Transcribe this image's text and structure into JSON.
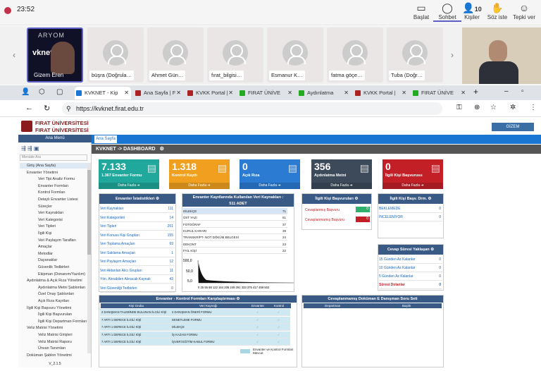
{
  "teams": {
    "time": "23:52",
    "buttons": [
      {
        "label": "Başlat",
        "icon": "▭"
      },
      {
        "label": "Sohbet",
        "icon": "◯"
      },
      {
        "label": "Kişiler",
        "icon": "👤",
        "count": "10"
      },
      {
        "label": "Söz iste",
        "icon": "✋"
      },
      {
        "label": "Tepki ver",
        "icon": "☺"
      }
    ]
  },
  "participants": [
    {
      "name": "Gizem Eren",
      "logo1": "ARYOM",
      "logo2": "vknet"
    },
    {
      "name": "büşra (Doğrula…"
    },
    {
      "name": "Ahmet Gün…"
    },
    {
      "name": "fırat_bilgisi…"
    },
    {
      "name": "Esmanur K…"
    },
    {
      "name": "fatma göçe…"
    },
    {
      "name": "Tuba (Doğr…"
    }
  ],
  "browser": {
    "tabs": [
      "KVKNET - Kip",
      "Ana Sayfa | F",
      "KVKK Portal |",
      "FIRAT ÜNİVE",
      "Aydınlatma",
      "KVKK Portal |",
      "FIRAT ÜNİVE"
    ],
    "url": "https://kvknet.firat.edu.tr"
  },
  "app": {
    "uni1": "FIRAT ÜNİVERSİTESİ",
    "uni2": "FIRAT ÜNİVERSİTESİ",
    "login": "GİZEM",
    "tab": "Ana Sayfa",
    "crumb": "KVKNET -> DASHBOARD",
    "menu_title": "Ana Menü",
    "search": "Menüde Ara",
    "version": "V_2.1.5",
    "menu": [
      "Giriş (Ana Sayfa)",
      "Envanter Yönetimi",
      "Veri Tipi Analiz Formu",
      "Envanter Formları",
      "Kontrol Formları",
      "Detaylı Envanter Listesi",
      "Süreçler",
      "Veri Kaynakları",
      "Veri Kategorisi",
      "Veri Tipleri",
      "İlgili Kişi",
      "Veri Paylaşım Tarafları",
      "Amaçlar",
      "Metodlar",
      "Dayanaklar",
      "Güvenlik Tedbirleri",
      "Ekipman (Donanım/Yazılım)",
      "Aydınlatma & Açık Rıza Yönetimi",
      "Aydınlatma Metni Şablonları",
      "Özel Onay Şablonları",
      "Açık Rıza Kayıtları",
      "İlgili Kişi Başvuru Yönetimi",
      "İlgili Kişi Başvuruları",
      "İlgili Kişi Departman Formları",
      "Veliz Matrisi Yönetimi",
      "Veliz Matrisi Girişleri",
      "Veliz Matrisi Raporu",
      "Ünvan Tanımları",
      "Doküman Şablon Yönetimi"
    ],
    "cards": [
      {
        "value": "7.133",
        "label": "1.367 Envanter Formu",
        "more": "Daha Fazla",
        "color": "#1fa89b"
      },
      {
        "value": "1.318",
        "label": "Kontrol Kaydı",
        "more": "Daha Fazla",
        "color": "#f0a01e"
      },
      {
        "value": "0",
        "label": "Açık Rıza",
        "more": "Daha Fazla",
        "color": "#2b7bd3"
      },
      {
        "value": "356",
        "label": "Aydınlatma Metni",
        "more": "Daha Fazla",
        "color": "#3d4a5a"
      },
      {
        "value": "0",
        "label": "İlgili Kişi Başvurusu",
        "more": "Daha Fazla",
        "color": "#c31f27"
      }
    ],
    "stats": {
      "title": "Envanter İstatistikleri",
      "rows": [
        [
          "Veri Kaynakları",
          "111"
        ],
        [
          "Veri Kategorileri",
          "14"
        ],
        [
          "Veri Tipleri",
          "261"
        ],
        [
          "Veri Konusu Kişi Grupları",
          "155"
        ],
        [
          "Veri Toplama Amaçları",
          "69"
        ],
        [
          "Veri Saklama Amaçları",
          "1"
        ],
        [
          "Veri Paylaşım Amaçları",
          "12"
        ],
        [
          "Veri Aktarılan Alıcı Grupları",
          "11"
        ],
        [
          "Yön. Alınabilen Alınacak Kaynak",
          "43"
        ],
        [
          "Veri Güvenliği Tedbirleri",
          "0"
        ]
      ]
    },
    "sources": {
      "title": "Envanter Kayıtlarında Kullanılan Veri Kaynakları :",
      "sub": "511 ADET",
      "rows": [
        [
          "DİLEKÇE",
          "71"
        ],
        [
          "ÜST YAZI",
          "51"
        ],
        [
          "FOTOĞRAF",
          "37"
        ],
        [
          "KURUL KARARI",
          "39"
        ],
        [
          "TRANSKRİPT- NOT DÖKÜM BELGESİ",
          "24"
        ],
        [
          "DEKONT",
          "23"
        ],
        [
          "FAİL KİŞİ",
          "22"
        ]
      ]
    },
    "chart_data": {
      "type": "area",
      "y_ticks": [
        "500,0",
        "50,0",
        "5,0"
      ],
      "x_ticks": "0 25 55 88 122 164 206 249 291 333 375 417 459 502"
    },
    "app_panel": {
      "title": "İlgili Kişi Başvuruları",
      "rows": [
        "Cevaplanmış Başvuru",
        "Cevaplanmamış Başvuru"
      ],
      "vals": [
        "0",
        "0"
      ]
    },
    "dept": {
      "title": "İlgili Kişi Başv. Drm.",
      "rows": [
        [
          "BEKLEMEDE",
          "0"
        ],
        [
          "İNCELENİYOR",
          "0"
        ]
      ]
    },
    "resp": {
      "title": "Cevap Süresi Yaklaşan",
      "rows": [
        [
          "15 Günden Az Kalanlar",
          "0"
        ],
        [
          "10 Günden Az Kalanlar",
          "0"
        ],
        [
          "5 Günden Az Kalanlar",
          "0"
        ],
        [
          "Süresi Dolanlar",
          "0"
        ]
      ]
    },
    "compare": {
      "title": "Envanter - Kontrol Formları Karşılaştırması",
      "cols": [
        "Kişi Grubu",
        "Veri Kaynağı",
        "Envanter",
        "Kontrol"
      ],
      "rows": [
        [
          "2 DANIŞMAN TALEBİNDE BULUNAN İLGİLİ KİŞİ",
          "2 DANIŞMAN ÖNERİ FORMU"
        ],
        [
          "7 ARTI 1 DERECE İLGİLİ KİŞİ",
          "DENETLEME FORMU"
        ],
        [
          "7 ARTI 1 DERECE İLGİLİ KİŞİ",
          "DİLEKÇE"
        ],
        [
          "7 ARTI 1 DERECE İLGİLİ KİŞİ",
          "İŞ KAZASI FORMU"
        ],
        [
          "7 ARTI 1 DERECE İLGİLİ KİŞİ",
          "İŞVERİ EĞİTİM KABUL FORMU"
        ]
      ],
      "legend": "Envanter ve Kontrol Formları Mevcut"
    },
    "unanswered": {
      "title": "Cevaplanmamış Doküman E Danışman Soru Seti",
      "cols": [
        "Departman",
        "Başlık"
      ]
    }
  }
}
